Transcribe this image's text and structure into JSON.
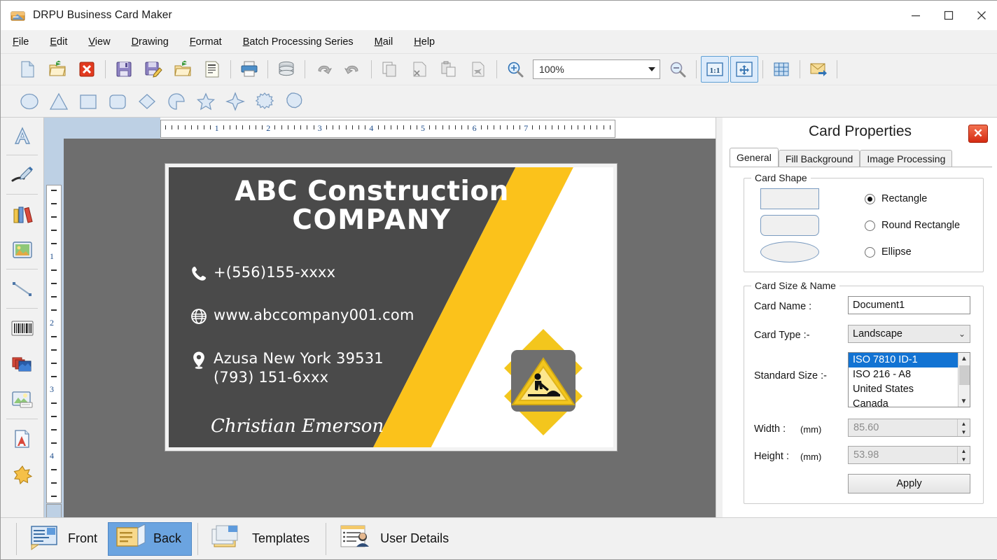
{
  "window": {
    "title": "DRPU Business Card Maker",
    "app_icon": "card-app-icon",
    "minimize": "–",
    "maximize": "❑",
    "close": "✕"
  },
  "menu": {
    "items": [
      {
        "mnemonic": "F",
        "rest": "ile",
        "name": "file"
      },
      {
        "mnemonic": "E",
        "rest": "dit",
        "name": "edit"
      },
      {
        "mnemonic": "V",
        "rest": "iew",
        "name": "view"
      },
      {
        "mnemonic": "D",
        "rest": "rawing",
        "name": "drawing"
      },
      {
        "mnemonic": "F",
        "rest": "ormat",
        "name": "format"
      },
      {
        "mnemonic": "B",
        "rest": "atch Processing Series",
        "name": "batch-processing-series"
      },
      {
        "mnemonic": "M",
        "rest": "ail",
        "name": "mail"
      },
      {
        "mnemonic": "H",
        "rest": "elp",
        "name": "help"
      }
    ]
  },
  "toolbar": {
    "buttons": [
      "new-document-icon",
      "open-folder-icon",
      "close-document-icon",
      "save-icon",
      "save-as-icon",
      "import-icon",
      "document-properties-icon",
      "print-icon",
      "database-icon",
      "undo-icon",
      "redo-icon",
      "copy-icon",
      "cut-icon",
      "paste-icon",
      "delete-icon",
      "zoom-in-icon"
    ],
    "zoom_value": "100%",
    "zoom_out_icon": "zoom-out-icon",
    "actual_size_label": "1:1",
    "fit_page_icon": "fit-page-icon",
    "grid_icon": "grid-icon",
    "email-icon": "email-icon"
  },
  "shapes_toolbar": {
    "shapes": [
      "ellipse-shape-icon",
      "triangle-shape-icon",
      "rectangle-shape-icon",
      "rounded-rectangle-shape-icon",
      "diamond-shape-icon",
      "pie-shape-icon",
      "star5-shape-icon",
      "star4-shape-icon",
      "starburst-shape-icon",
      "polygon-shape-icon"
    ]
  },
  "left_toolbar": {
    "tools": [
      "text-tool-icon",
      "signature-tool-icon",
      "library-tool-icon",
      "image-tool-icon",
      "line-tool-icon",
      "barcode-tool-icon",
      "layers-tool-icon",
      "watermark-tool-icon",
      "text-art-tool-icon",
      "clipart-tool-icon"
    ]
  },
  "rulers": {
    "horizontal_labels": [
      "1",
      "2",
      "3",
      "4",
      "5",
      "6",
      "7"
    ],
    "vertical_labels": [
      "1",
      "2",
      "3",
      "4"
    ]
  },
  "card": {
    "company_line1": "ABC Construction",
    "company_line2": "COMPANY",
    "phone": "+(556)155-xxxx",
    "website": "www.abccompany001.com",
    "address_line1": "Azusa New York 39531",
    "address_line2": "(793) 151-6xxx",
    "signature": "Christian Emerson",
    "phone_icon": "phone-icon",
    "globe_icon": "globe-icon",
    "location_icon": "location-pin-icon",
    "logo_icon": "construction-sign-logo",
    "colors": {
      "dark": "#4a4a4a",
      "accent": "#fbc21b",
      "background": "#ffffff",
      "canvas": "#6e6e6e"
    }
  },
  "properties_panel": {
    "title": "Card Properties",
    "close_icon": "close-panel-icon",
    "tabs": [
      {
        "label": "General",
        "selected": true
      },
      {
        "label": "Fill Background",
        "selected": false
      },
      {
        "label": "Image Processing",
        "selected": false
      }
    ],
    "card_shape": {
      "legend": "Card Shape",
      "options": [
        {
          "label": "Rectangle",
          "selected": true,
          "preview": "rectangle-preview"
        },
        {
          "label": "Round Rectangle",
          "selected": false,
          "preview": "round-rectangle-preview"
        },
        {
          "label": "Ellipse",
          "selected": false,
          "preview": "ellipse-preview"
        }
      ]
    },
    "card_size_name": {
      "legend": "Card Size & Name",
      "card_name_label": "Card Name :",
      "card_name_value": "Document1",
      "card_type_label": "Card Type :-",
      "card_type_value": "Landscape",
      "standard_size_label": "Standard Size :-",
      "standard_size_options": [
        "ISO 7810 ID-1",
        "ISO 216 - A8",
        "United States",
        "Canada"
      ],
      "standard_size_selected": "ISO 7810 ID-1",
      "width_label": "Width :",
      "width_unit": "(mm)",
      "width_value": "85.60",
      "height_label": "Height :",
      "height_unit": "(mm)",
      "height_value": "53.98",
      "apply_label": "Apply"
    }
  },
  "bottom_tabs": [
    {
      "label": "Front",
      "icon": "card-front-icon",
      "selected": false
    },
    {
      "label": "Back",
      "icon": "card-back-icon",
      "selected": true
    },
    {
      "label": "Templates",
      "icon": "templates-icon",
      "selected": false
    },
    {
      "label": "User Details",
      "icon": "user-details-icon",
      "selected": false
    }
  ]
}
